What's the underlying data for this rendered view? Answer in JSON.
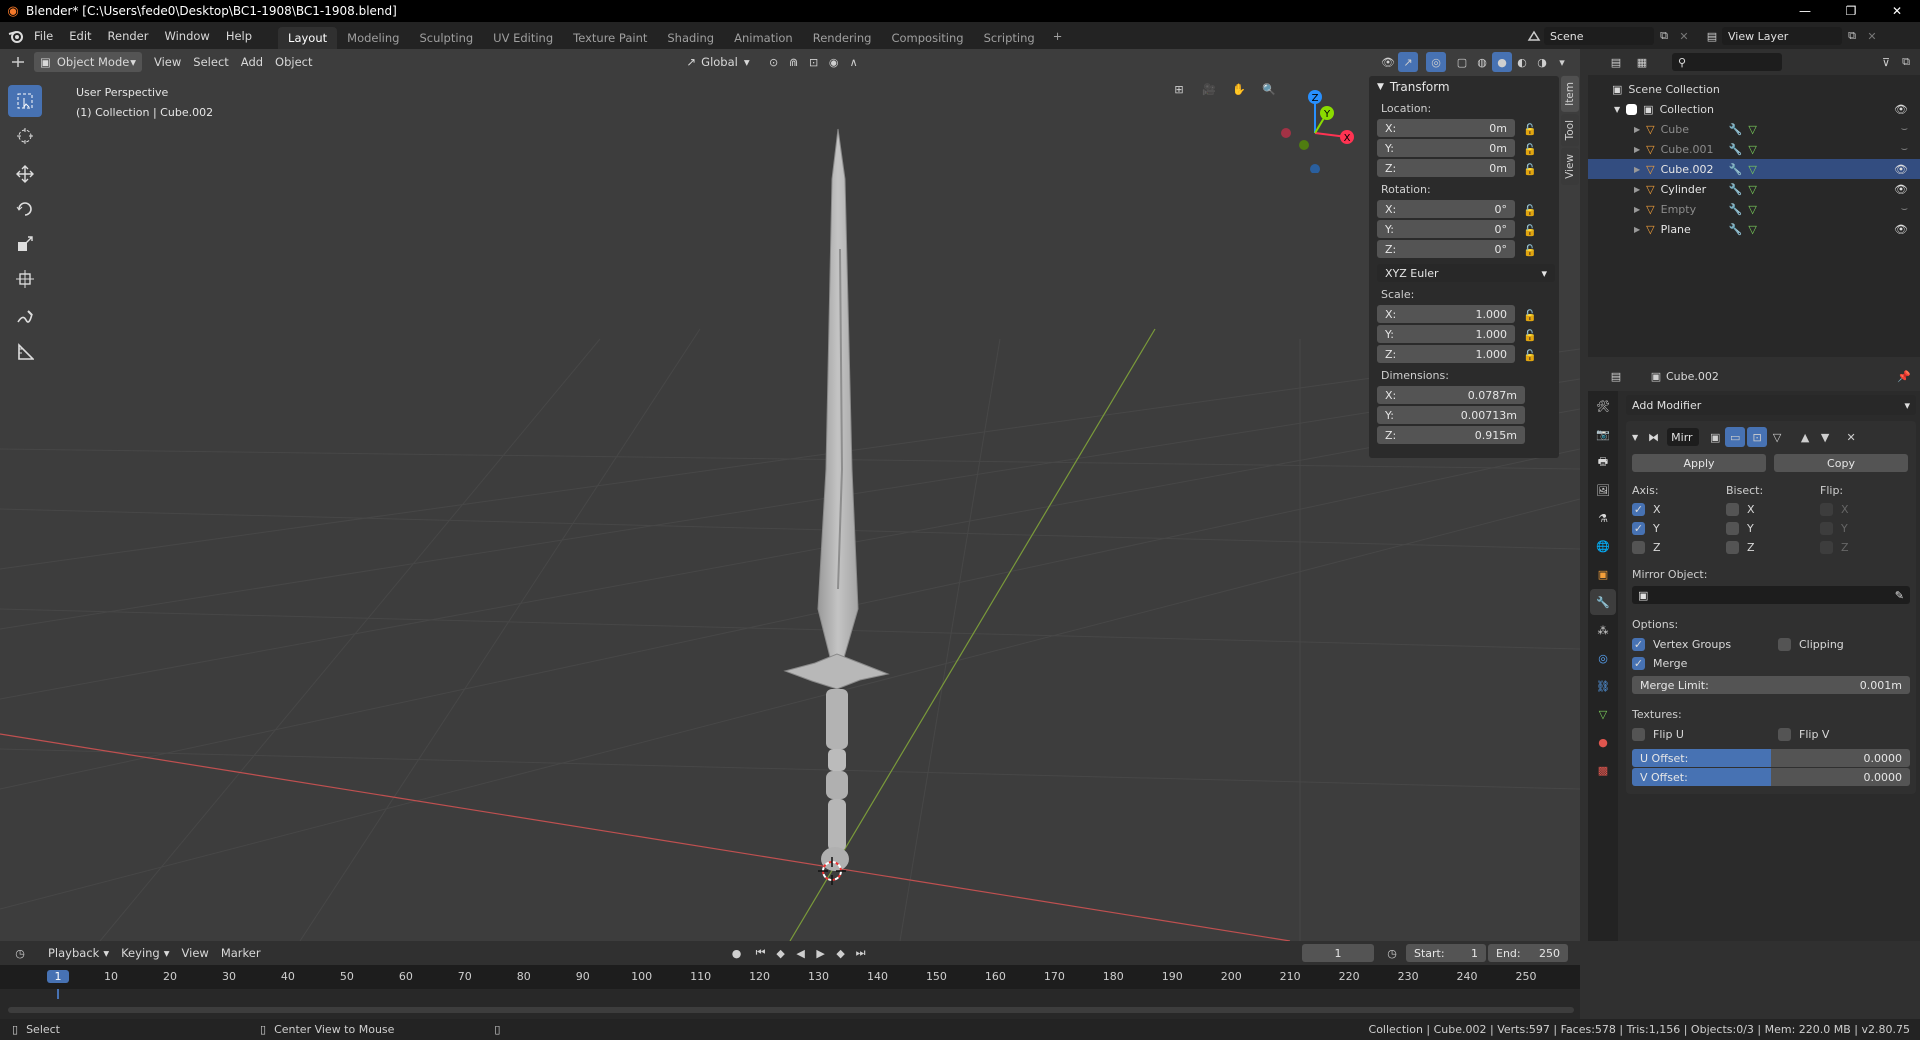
{
  "title": "Blender* [C:\\Users\\fede0\\Desktop\\BC1-1908\\BC1-1908.blend]",
  "window_controls": {
    "minimize": "—",
    "restore": "❐",
    "close": "✕"
  },
  "menus": [
    "File",
    "Edit",
    "Render",
    "Window",
    "Help"
  ],
  "workspaces": [
    "Layout",
    "Modeling",
    "Sculpting",
    "UV Editing",
    "Texture Paint",
    "Shading",
    "Animation",
    "Rendering",
    "Compositing",
    "Scripting"
  ],
  "active_workspace": "Layout",
  "add_workspace": "+",
  "scene": {
    "name": "Scene",
    "view_layer": "View Layer"
  },
  "viewport_header": {
    "mode": "Object Mode",
    "menus": [
      "View",
      "Select",
      "Add",
      "Object"
    ],
    "orientation": "Global"
  },
  "viewport": {
    "perspective": "User Perspective",
    "collection": "(1) Collection | Cube.002"
  },
  "gizmo": {
    "x": "X",
    "y": "Y",
    "z": "Z"
  },
  "n_panel": {
    "title": "Transform",
    "location_label": "Location:",
    "location": [
      {
        "axis": "X:",
        "value": "0m"
      },
      {
        "axis": "Y:",
        "value": "0m"
      },
      {
        "axis": "Z:",
        "value": "0m"
      }
    ],
    "rotation_label": "Rotation:",
    "rotation": [
      {
        "axis": "X:",
        "value": "0°"
      },
      {
        "axis": "Y:",
        "value": "0°"
      },
      {
        "axis": "Z:",
        "value": "0°"
      }
    ],
    "rotation_mode": "XYZ Euler",
    "scale_label": "Scale:",
    "scale": [
      {
        "axis": "X:",
        "value": "1.000"
      },
      {
        "axis": "Y:",
        "value": "1.000"
      },
      {
        "axis": "Z:",
        "value": "1.000"
      }
    ],
    "dimensions_label": "Dimensions:",
    "dimensions": [
      {
        "axis": "X:",
        "value": "0.0787m"
      },
      {
        "axis": "Y:",
        "value": "0.00713m"
      },
      {
        "axis": "Z:",
        "value": "0.915m"
      }
    ],
    "tabs": [
      "Item",
      "Tool",
      "View"
    ]
  },
  "outliner": {
    "root": "Scene Collection",
    "collection": "Collection",
    "items": [
      {
        "name": "Cube",
        "dim": true
      },
      {
        "name": "Cube.001",
        "dim": true
      },
      {
        "name": "Cube.002",
        "dim": false,
        "selected": true
      },
      {
        "name": "Cylinder",
        "dim": false
      },
      {
        "name": "Empty",
        "dim": true
      },
      {
        "name": "Plane",
        "dim": false
      }
    ]
  },
  "properties": {
    "object": "Cube.002",
    "add_modifier": "Add Modifier",
    "modifier_name": "Mirr",
    "apply": "Apply",
    "copy": "Copy",
    "axis_label": "Axis:",
    "bisect_label": "Bisect:",
    "flip_label": "Flip:",
    "axes": [
      "X",
      "Y",
      "Z"
    ],
    "axis_checked": [
      true,
      true,
      false
    ],
    "mirror_object_label": "Mirror Object:",
    "options_label": "Options:",
    "vertex_groups": "Vertex Groups",
    "clipping": "Clipping",
    "merge": "Merge",
    "merge_limit_label": "Merge Limit:",
    "merge_limit": "0.001m",
    "textures_label": "Textures:",
    "flip_u": "Flip U",
    "flip_v": "Flip V",
    "u_offset_label": "U Offset:",
    "u_offset": "0.0000",
    "v_offset_label": "V Offset:",
    "v_offset": "0.0000"
  },
  "timeline": {
    "menus": [
      "Playback",
      "Keying",
      "View",
      "Marker"
    ],
    "current_frame": "1",
    "start_label": "Start:",
    "start": "1",
    "end_label": "End:",
    "end": "250",
    "ticks": [
      "1",
      "10",
      "20",
      "30",
      "40",
      "50",
      "60",
      "70",
      "80",
      "90",
      "100",
      "110",
      "120",
      "130",
      "140",
      "150",
      "160",
      "170",
      "180",
      "190",
      "200",
      "210",
      "220",
      "230",
      "240",
      "250"
    ]
  },
  "status": {
    "left": "Select",
    "middle": "Center View to Mouse",
    "right": "Collection | Cube.002 | Verts:597 | Faces:578 | Tris:1,156 | Objects:0/3 | Mem: 220.0 MB | v2.80.75"
  },
  "colors": {
    "accent": "#4772b3",
    "x_axis": "#ff3352",
    "y_axis": "#8bdc00",
    "z_axis": "#2890ff",
    "selection": "#334d80"
  }
}
